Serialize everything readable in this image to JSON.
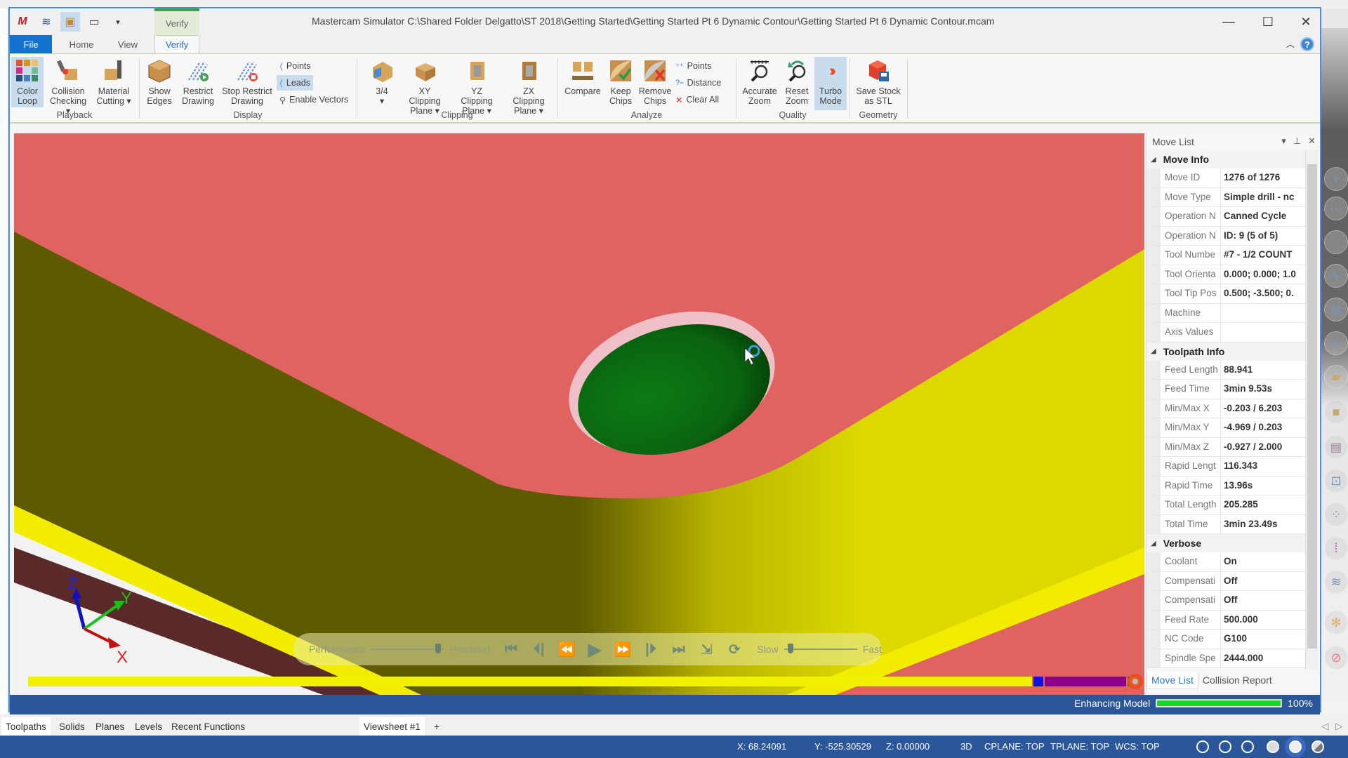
{
  "app": {
    "title": "Mastercam Simulator  C:\\Shared Folder Delgatto\\ST 2018\\Getting Started\\Getting Started Pt 6 Dynamic Contour\\Getting Started Pt 6 Dynamic Contour.mcam",
    "context_tab": "Verify",
    "window_controls": {
      "minimize": "—",
      "maximize": "☐",
      "close": "✕"
    }
  },
  "quick_access": [
    {
      "name": "mastercam-logo-icon",
      "glyph": "M"
    },
    {
      "name": "waves-icon",
      "glyph": "≋"
    },
    {
      "name": "verify-icon",
      "glyph": "▣"
    },
    {
      "name": "monitor-icon",
      "glyph": "🖵"
    },
    {
      "name": "customize-dropdown-icon",
      "glyph": "▾"
    }
  ],
  "tabs": [
    {
      "label": "File"
    },
    {
      "label": "Home"
    },
    {
      "label": "View"
    },
    {
      "label": "Verify"
    }
  ],
  "ribbon": {
    "groups": [
      {
        "label": "Playback"
      },
      {
        "label": "Display"
      },
      {
        "label": "Clipping"
      },
      {
        "label": "Analyze"
      },
      {
        "label": "Quality"
      },
      {
        "label": "Geometry"
      }
    ],
    "buttons": {
      "color_loop": "Color\nLoop",
      "collision_checking": "Collision\nChecking ▾",
      "material_cutting": "Material\nCutting ▾",
      "show_edges": "Show\nEdges",
      "restrict_drawing": "Restrict\nDrawing",
      "stop_restrict_drawing": "Stop Restrict\nDrawing",
      "points": "Points",
      "leads": "Leads",
      "enable_vectors": "Enable Vectors",
      "three_quarter": "3/4\n▾",
      "xy_clipping": "XY Clipping\nPlane ▾",
      "yz_clipping": "YZ Clipping\nPlane ▾",
      "zx_clipping": "ZX Clipping\nPlane ▾",
      "compare": "Compare",
      "keep_chips": "Keep\nChips",
      "remove_chips": "Remove\nChips",
      "analyze_points": "Points",
      "distance": "Distance",
      "clear_all": "Clear All",
      "accurate_zoom": "Accurate\nZoom",
      "reset_zoom": "Reset\nZoom",
      "turbo_mode": "Turbo\nMode",
      "save_stock_stl": "Save Stock\nas STL"
    }
  },
  "playback": {
    "performance": "Performance",
    "precision": "Precision",
    "slow": "Slow",
    "fast": "Fast",
    "quality_slider": 0.9,
    "speed_slider": 0.05
  },
  "timeline": {
    "colors": {
      "toolpath": "#f2f200",
      "blue": "#1010e0",
      "purple": "#8b008b",
      "green": "#128a12",
      "knob": "#f05a28"
    }
  },
  "move_list": {
    "title": "Move List",
    "sections": [
      {
        "label": "Move Info",
        "rows": [
          {
            "key": "Move ID",
            "value": "1276 of 1276"
          },
          {
            "key": "Move Type",
            "value": "Simple drill - nc"
          },
          {
            "key": "Operation N",
            "value": "Canned Cycle"
          },
          {
            "key": "Operation N",
            "value": "ID: 9 (5 of 5)"
          },
          {
            "key": "Tool Numbe",
            "value": "#7 - 1/2 COUNT"
          },
          {
            "key": "Tool Orienta",
            "value": "0.000; 0.000; 1.0"
          },
          {
            "key": "Tool Tip Pos",
            "value": "0.500; -3.500; 0."
          },
          {
            "key": "Machine",
            "value": ""
          },
          {
            "key": "Axis Values",
            "value": ""
          }
        ]
      },
      {
        "label": "Toolpath Info",
        "rows": [
          {
            "key": "Feed Length",
            "value": "88.941"
          },
          {
            "key": "Feed Time",
            "value": "3min 9.53s"
          },
          {
            "key": "Min/Max X",
            "value": "-0.203 / 6.203"
          },
          {
            "key": "Min/Max Y",
            "value": "-4.969 / 0.203"
          },
          {
            "key": "Min/Max Z",
            "value": "-0.927 / 2.000"
          },
          {
            "key": "Rapid Lengt",
            "value": "116.343"
          },
          {
            "key": "Rapid Time",
            "value": "13.96s"
          },
          {
            "key": "Total Length",
            "value": "205.285"
          },
          {
            "key": "Total Time",
            "value": "3min 23.49s"
          }
        ]
      },
      {
        "label": "Verbose",
        "rows": [
          {
            "key": "Coolant",
            "value": "On"
          },
          {
            "key": "Compensati",
            "value": "Off"
          },
          {
            "key": "Compensati",
            "value": "Off"
          },
          {
            "key": "Feed Rate",
            "value": "500.000"
          },
          {
            "key": "NC Code",
            "value": "G100"
          },
          {
            "key": "Spindle Spe",
            "value": "2444.000"
          }
        ]
      }
    ],
    "tabs": [
      "Move List",
      "Collision Report"
    ]
  },
  "enhancing": {
    "label": "Enhancing Model",
    "percent_text": "100%",
    "progress": 1.0
  },
  "bottom_tabs": [
    "Toolpaths",
    "Solids",
    "Planes",
    "Levels",
    "Recent Functions"
  ],
  "viewsheets": [
    "Viewsheet #1",
    "+"
  ],
  "status": {
    "x": "X:  68.24091",
    "y": "Y:  -525.30529",
    "z": "Z:  0.00000",
    "mode": "3D",
    "cplane": "CPLANE: TOP",
    "tplane": "TPLANE: TOP",
    "wcs": "WCS: TOP"
  },
  "axis_labels": {
    "x": "X",
    "y": "Y",
    "z": "Z"
  },
  "colors": {
    "stock_top": "#df6360",
    "wall_olive": "#5e5a00",
    "wall_yellow": "#dcd800",
    "bright_yellow": "#f5ee00",
    "maroon": "#5a2a2a",
    "hole_green": "#0a6e12",
    "accent_blue": "#2b579a"
  }
}
